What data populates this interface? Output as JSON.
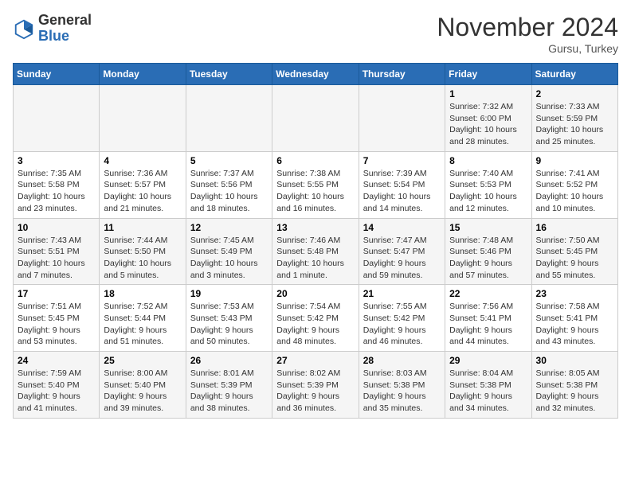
{
  "header": {
    "logo_line1": "General",
    "logo_line2": "Blue",
    "month": "November 2024",
    "location": "Gursu, Turkey"
  },
  "days_of_week": [
    "Sunday",
    "Monday",
    "Tuesday",
    "Wednesday",
    "Thursday",
    "Friday",
    "Saturday"
  ],
  "weeks": [
    [
      {
        "day": "",
        "info": ""
      },
      {
        "day": "",
        "info": ""
      },
      {
        "day": "",
        "info": ""
      },
      {
        "day": "",
        "info": ""
      },
      {
        "day": "",
        "info": ""
      },
      {
        "day": "1",
        "info": "Sunrise: 7:32 AM\nSunset: 6:00 PM\nDaylight: 10 hours and 28 minutes."
      },
      {
        "day": "2",
        "info": "Sunrise: 7:33 AM\nSunset: 5:59 PM\nDaylight: 10 hours and 25 minutes."
      }
    ],
    [
      {
        "day": "3",
        "info": "Sunrise: 7:35 AM\nSunset: 5:58 PM\nDaylight: 10 hours and 23 minutes."
      },
      {
        "day": "4",
        "info": "Sunrise: 7:36 AM\nSunset: 5:57 PM\nDaylight: 10 hours and 21 minutes."
      },
      {
        "day": "5",
        "info": "Sunrise: 7:37 AM\nSunset: 5:56 PM\nDaylight: 10 hours and 18 minutes."
      },
      {
        "day": "6",
        "info": "Sunrise: 7:38 AM\nSunset: 5:55 PM\nDaylight: 10 hours and 16 minutes."
      },
      {
        "day": "7",
        "info": "Sunrise: 7:39 AM\nSunset: 5:54 PM\nDaylight: 10 hours and 14 minutes."
      },
      {
        "day": "8",
        "info": "Sunrise: 7:40 AM\nSunset: 5:53 PM\nDaylight: 10 hours and 12 minutes."
      },
      {
        "day": "9",
        "info": "Sunrise: 7:41 AM\nSunset: 5:52 PM\nDaylight: 10 hours and 10 minutes."
      }
    ],
    [
      {
        "day": "10",
        "info": "Sunrise: 7:43 AM\nSunset: 5:51 PM\nDaylight: 10 hours and 7 minutes."
      },
      {
        "day": "11",
        "info": "Sunrise: 7:44 AM\nSunset: 5:50 PM\nDaylight: 10 hours and 5 minutes."
      },
      {
        "day": "12",
        "info": "Sunrise: 7:45 AM\nSunset: 5:49 PM\nDaylight: 10 hours and 3 minutes."
      },
      {
        "day": "13",
        "info": "Sunrise: 7:46 AM\nSunset: 5:48 PM\nDaylight: 10 hours and 1 minute."
      },
      {
        "day": "14",
        "info": "Sunrise: 7:47 AM\nSunset: 5:47 PM\nDaylight: 9 hours and 59 minutes."
      },
      {
        "day": "15",
        "info": "Sunrise: 7:48 AM\nSunset: 5:46 PM\nDaylight: 9 hours and 57 minutes."
      },
      {
        "day": "16",
        "info": "Sunrise: 7:50 AM\nSunset: 5:45 PM\nDaylight: 9 hours and 55 minutes."
      }
    ],
    [
      {
        "day": "17",
        "info": "Sunrise: 7:51 AM\nSunset: 5:45 PM\nDaylight: 9 hours and 53 minutes."
      },
      {
        "day": "18",
        "info": "Sunrise: 7:52 AM\nSunset: 5:44 PM\nDaylight: 9 hours and 51 minutes."
      },
      {
        "day": "19",
        "info": "Sunrise: 7:53 AM\nSunset: 5:43 PM\nDaylight: 9 hours and 50 minutes."
      },
      {
        "day": "20",
        "info": "Sunrise: 7:54 AM\nSunset: 5:42 PM\nDaylight: 9 hours and 48 minutes."
      },
      {
        "day": "21",
        "info": "Sunrise: 7:55 AM\nSunset: 5:42 PM\nDaylight: 9 hours and 46 minutes."
      },
      {
        "day": "22",
        "info": "Sunrise: 7:56 AM\nSunset: 5:41 PM\nDaylight: 9 hours and 44 minutes."
      },
      {
        "day": "23",
        "info": "Sunrise: 7:58 AM\nSunset: 5:41 PM\nDaylight: 9 hours and 43 minutes."
      }
    ],
    [
      {
        "day": "24",
        "info": "Sunrise: 7:59 AM\nSunset: 5:40 PM\nDaylight: 9 hours and 41 minutes."
      },
      {
        "day": "25",
        "info": "Sunrise: 8:00 AM\nSunset: 5:40 PM\nDaylight: 9 hours and 39 minutes."
      },
      {
        "day": "26",
        "info": "Sunrise: 8:01 AM\nSunset: 5:39 PM\nDaylight: 9 hours and 38 minutes."
      },
      {
        "day": "27",
        "info": "Sunrise: 8:02 AM\nSunset: 5:39 PM\nDaylight: 9 hours and 36 minutes."
      },
      {
        "day": "28",
        "info": "Sunrise: 8:03 AM\nSunset: 5:38 PM\nDaylight: 9 hours and 35 minutes."
      },
      {
        "day": "29",
        "info": "Sunrise: 8:04 AM\nSunset: 5:38 PM\nDaylight: 9 hours and 34 minutes."
      },
      {
        "day": "30",
        "info": "Sunrise: 8:05 AM\nSunset: 5:38 PM\nDaylight: 9 hours and 32 minutes."
      }
    ]
  ]
}
